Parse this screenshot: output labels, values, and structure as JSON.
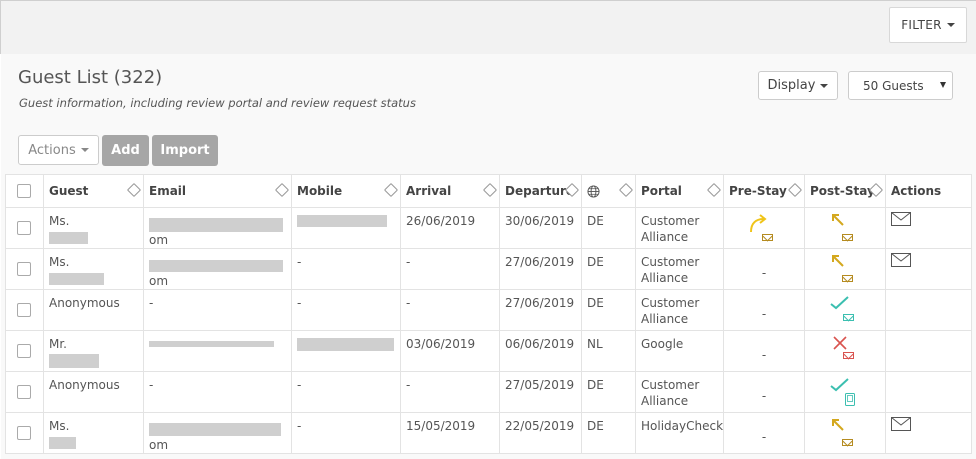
{
  "filter": {
    "label": "FILTER"
  },
  "header": {
    "title": "Guest List (322)",
    "subtitle": "Guest information, including review portal and review request status"
  },
  "toolbar": {
    "display_label": "Display",
    "page_size": "50 Guests",
    "actions_label": "Actions",
    "add_label": "Add",
    "import_label": "Import"
  },
  "table": {
    "columns": [
      "Guest",
      "Email",
      "Mobile",
      "Arrival",
      "Departure",
      "",
      "Portal",
      "Pre-Stay",
      "Post-Stay",
      "Actions"
    ],
    "rows": [
      {
        "guest": "Ms.",
        "email_suffix": "om",
        "mobile": "",
        "arrival": "26/06/2019",
        "departure": "30/06/2019",
        "country": "DE",
        "portal_1": "Customer",
        "portal_2": "Alliance",
        "pre_stay": "",
        "post_stay": ""
      },
      {
        "guest": "Ms.",
        "email_suffix": "om",
        "mobile": "-",
        "arrival": "-",
        "departure": "27/06/2019",
        "country": "DE",
        "portal_1": "Customer",
        "portal_2": "Alliance",
        "pre_stay": "-",
        "post_stay": ""
      },
      {
        "guest": "Anonymous",
        "email_suffix": "",
        "email": "-",
        "mobile": "-",
        "arrival": "-",
        "departure": "27/06/2019",
        "country": "DE",
        "portal_1": "Customer",
        "portal_2": "Alliance",
        "pre_stay": "-",
        "post_stay": ""
      },
      {
        "guest": "Mr.",
        "email_suffix": "",
        "mobile": "",
        "arrival": "03/06/2019",
        "departure": "06/06/2019",
        "country": "NL",
        "portal_1": "Google",
        "portal_2": "",
        "pre_stay": "-",
        "post_stay": ""
      },
      {
        "guest": "Anonymous",
        "email_suffix": "",
        "email": "-",
        "mobile": "-",
        "arrival": "-",
        "departure": "27/05/2019",
        "country": "DE",
        "portal_1": "Customer",
        "portal_2": "Alliance",
        "pre_stay": "-",
        "post_stay": ""
      },
      {
        "guest": "Ms.",
        "email_suffix": "om",
        "mobile": "-",
        "arrival": "15/05/2019",
        "departure": "22/05/2019",
        "country": "DE",
        "portal_1": "HolidayCheck",
        "portal_2": "",
        "pre_stay": "-",
        "post_stay": ""
      }
    ]
  },
  "icons": {
    "globe": "globe-icon",
    "mail": "envelope-icon",
    "accent": "#f0c419",
    "teal": "#3bbfb0",
    "red": "#d9534f"
  }
}
